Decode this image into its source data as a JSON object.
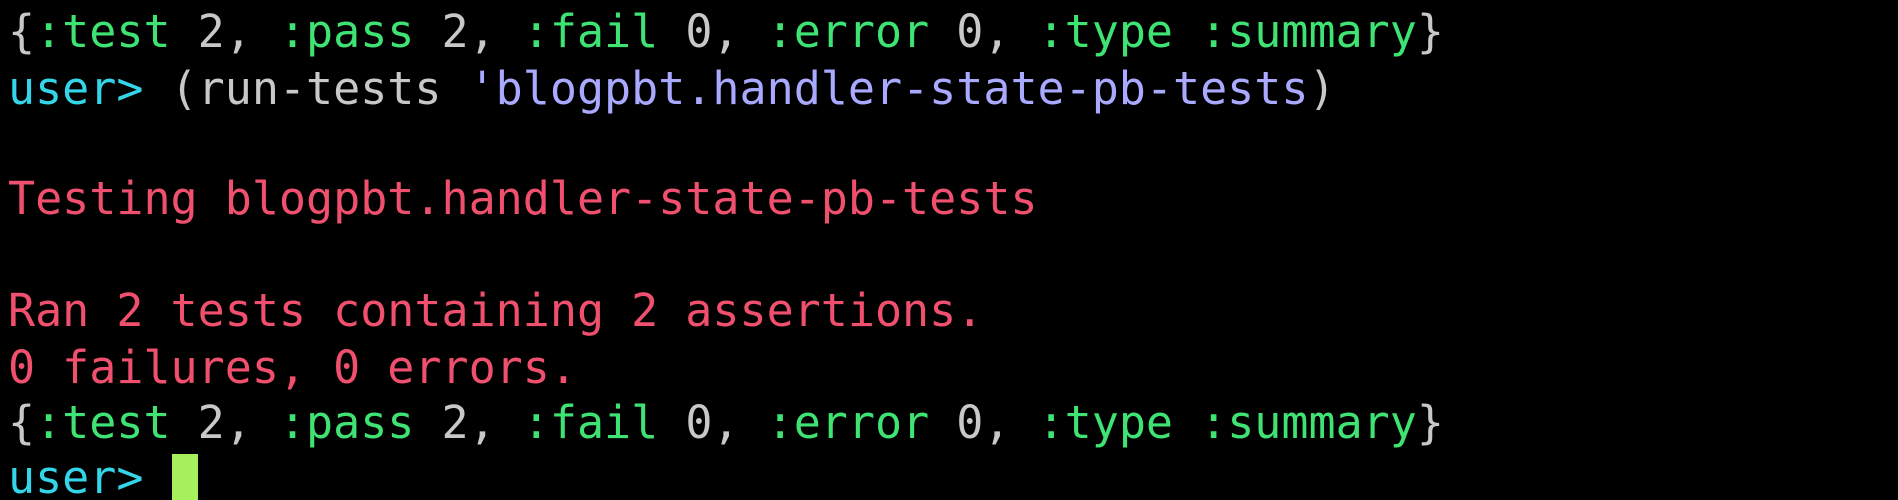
{
  "colors": {
    "background": "#000000",
    "keyword": "#3fe374",
    "value": "#c8c8c8",
    "symbol": "#a9a9ff",
    "output_red": "#f0506e",
    "prompt": "#33d6e8",
    "cursor": "#a8ef5c"
  },
  "summary_1": {
    "open": "{",
    "k_test": ":test",
    "v_test": " 2, ",
    "k_pass": ":pass",
    "v_pass": " 2, ",
    "k_fail": ":fail",
    "v_fail": " 0, ",
    "k_error": ":error",
    "v_error": " 0, ",
    "k_type": ":type",
    "sp": " ",
    "v_type": ":summary",
    "close": "}"
  },
  "command": {
    "prompt": "user>",
    "open": " (",
    "fn": "run-tests",
    "arg": " 'blogpbt.handler-state-pb-tests",
    "close": ")"
  },
  "testing_line": "Testing blogpbt.handler-state-pb-tests",
  "ran_line": "Ran 2 tests containing 2 assertions.",
  "failures_line": "0 failures, 0 errors.",
  "summary_2": {
    "open": "{",
    "k_test": ":test",
    "v_test": " 2, ",
    "k_pass": ":pass",
    "v_pass": " 2, ",
    "k_fail": ":fail",
    "v_fail": " 0, ",
    "k_error": ":error",
    "v_error": " 0, ",
    "k_type": ":type",
    "sp": " ",
    "v_type": ":summary",
    "close": "}"
  },
  "final_prompt": {
    "prompt": "user>",
    "space": " "
  }
}
